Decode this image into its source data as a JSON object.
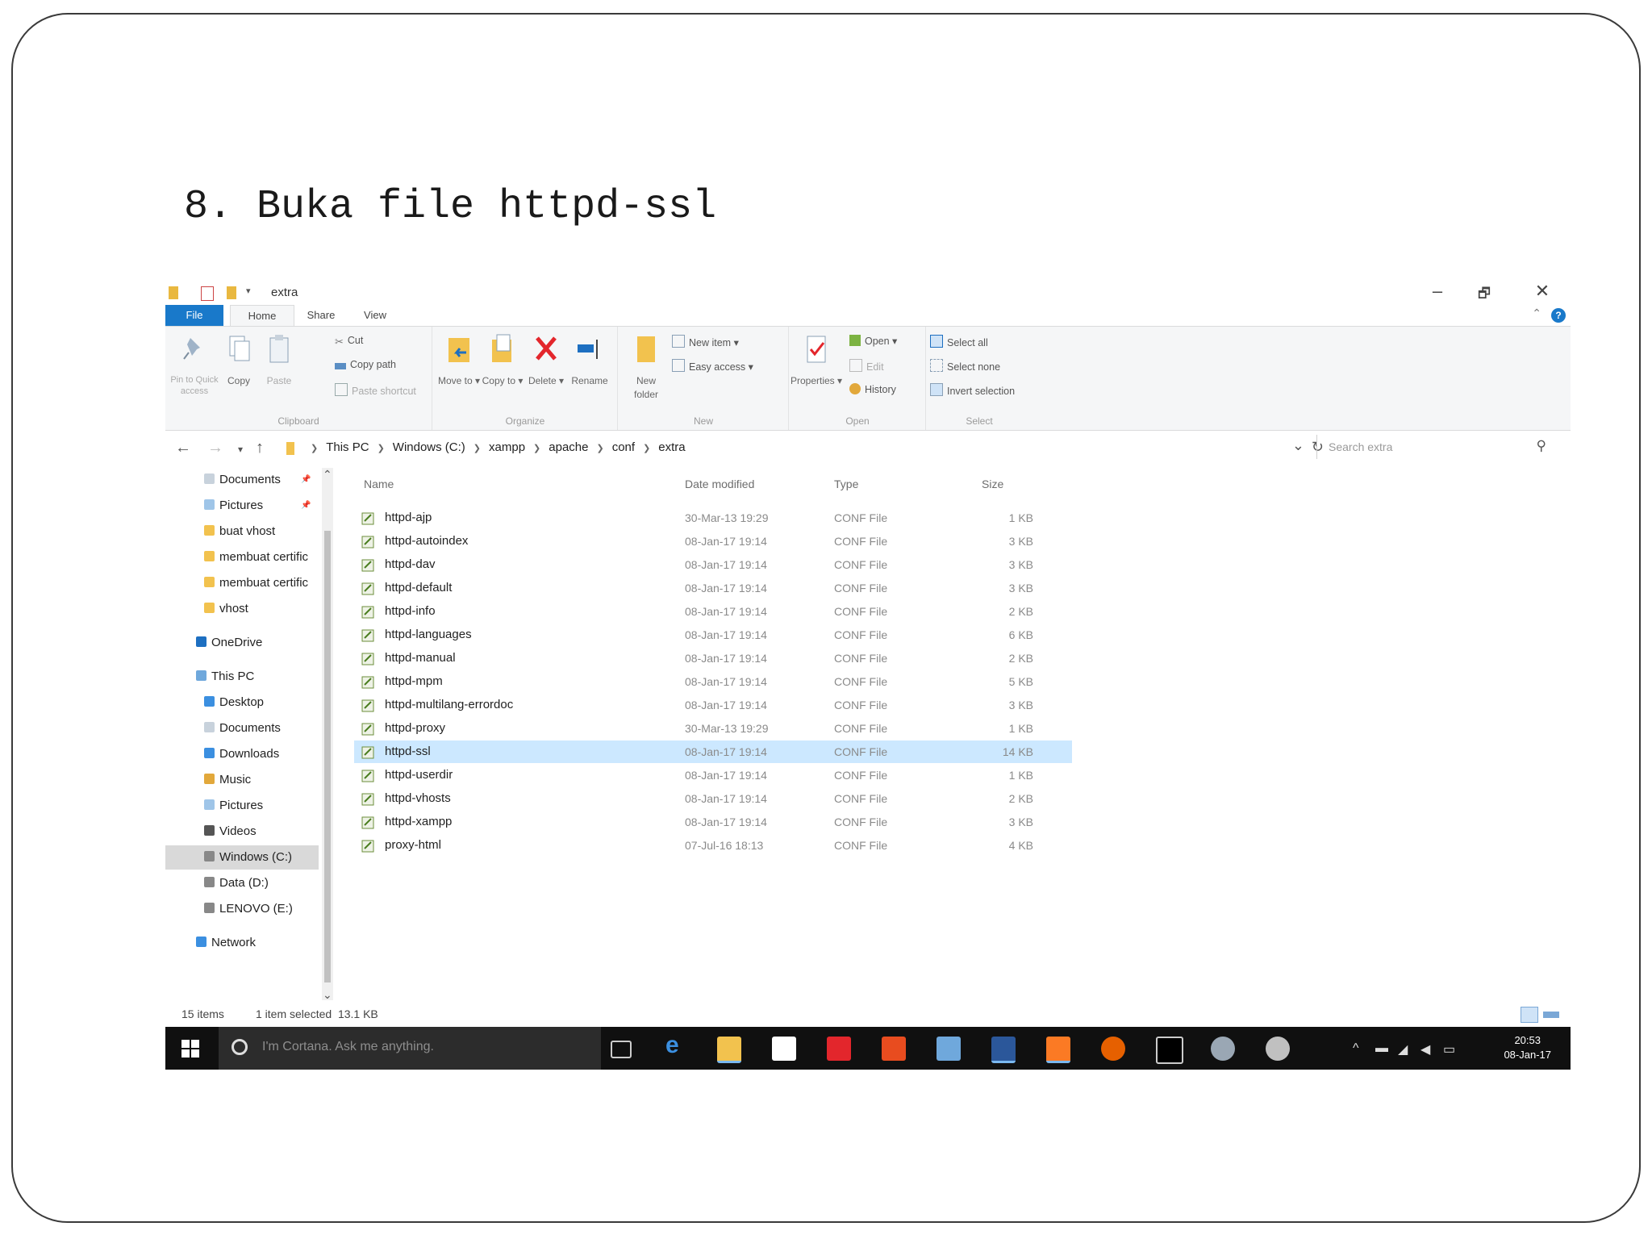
{
  "slide": {
    "title": "8. Buka file httpd-ssl"
  },
  "window": {
    "title": "extra",
    "minimize": "–",
    "restore": "🗗",
    "close": "✕",
    "tabs": {
      "file": "File",
      "home": "Home",
      "share": "Share",
      "view": "View"
    },
    "help": "?"
  },
  "ribbon": {
    "clipboard": {
      "label": "Clipboard",
      "pin": "Pin to Quick access",
      "copy": "Copy",
      "paste": "Paste",
      "cut": "Cut",
      "copy_path": "Copy path",
      "paste_shortcut": "Paste shortcut"
    },
    "organize": {
      "label": "Organize",
      "move_to": "Move to ▾",
      "copy_to": "Copy to ▾",
      "delete": "Delete ▾",
      "rename": "Rename"
    },
    "new": {
      "label": "New",
      "new_folder": "New folder",
      "new_item": "New item ▾",
      "easy_access": "Easy access ▾"
    },
    "open": {
      "label": "Open",
      "properties": "Properties ▾",
      "open": "Open ▾",
      "edit": "Edit",
      "history": "History"
    },
    "select": {
      "label": "Select",
      "select_all": "Select all",
      "select_none": "Select none",
      "invert": "Invert selection"
    }
  },
  "address": {
    "back": "←",
    "forward": "→",
    "recent": "▾",
    "up": "↑",
    "crumbs": [
      "This PC",
      "Windows (C:)",
      "xampp",
      "apache",
      "conf",
      "extra"
    ],
    "dropdown": "⌄",
    "refresh": "↻",
    "search_placeholder": "Search extra"
  },
  "nav": {
    "items": [
      {
        "label": "Documents",
        "pin": "📌"
      },
      {
        "label": "Pictures",
        "pin": "📌"
      },
      {
        "label": "buat vhost"
      },
      {
        "label": "membuat certific"
      },
      {
        "label": "membuat certific"
      },
      {
        "label": "vhost"
      },
      {
        "label": "OneDrive"
      },
      {
        "label": "This PC"
      },
      {
        "label": "Desktop"
      },
      {
        "label": "Documents"
      },
      {
        "label": "Downloads"
      },
      {
        "label": "Music"
      },
      {
        "label": "Pictures"
      },
      {
        "label": "Videos"
      },
      {
        "label": "Windows (C:)"
      },
      {
        "label": "Data (D:)"
      },
      {
        "label": "LENOVO (E:)"
      },
      {
        "label": "Network"
      }
    ],
    "scroll_up": "⌃",
    "scroll_down": "⌄"
  },
  "files": {
    "headers": {
      "name": "Name",
      "date": "Date modified",
      "type": "Type",
      "size": "Size"
    },
    "rows": [
      {
        "name": "httpd-ajp",
        "date": "30-Mar-13 19:29",
        "type": "CONF File",
        "size": "1 KB"
      },
      {
        "name": "httpd-autoindex",
        "date": "08-Jan-17 19:14",
        "type": "CONF File",
        "size": "3 KB"
      },
      {
        "name": "httpd-dav",
        "date": "08-Jan-17 19:14",
        "type": "CONF File",
        "size": "3 KB"
      },
      {
        "name": "httpd-default",
        "date": "08-Jan-17 19:14",
        "type": "CONF File",
        "size": "3 KB"
      },
      {
        "name": "httpd-info",
        "date": "08-Jan-17 19:14",
        "type": "CONF File",
        "size": "2 KB"
      },
      {
        "name": "httpd-languages",
        "date": "08-Jan-17 19:14",
        "type": "CONF File",
        "size": "6 KB"
      },
      {
        "name": "httpd-manual",
        "date": "08-Jan-17 19:14",
        "type": "CONF File",
        "size": "2 KB"
      },
      {
        "name": "httpd-mpm",
        "date": "08-Jan-17 19:14",
        "type": "CONF File",
        "size": "5 KB"
      },
      {
        "name": "httpd-multilang-errordoc",
        "date": "08-Jan-17 19:14",
        "type": "CONF File",
        "size": "3 KB"
      },
      {
        "name": "httpd-proxy",
        "date": "30-Mar-13 19:29",
        "type": "CONF File",
        "size": "1 KB"
      },
      {
        "name": "httpd-ssl",
        "date": "08-Jan-17 19:14",
        "type": "CONF File",
        "size": "14 KB"
      },
      {
        "name": "httpd-userdir",
        "date": "08-Jan-17 19:14",
        "type": "CONF File",
        "size": "1 KB"
      },
      {
        "name": "httpd-vhosts",
        "date": "08-Jan-17 19:14",
        "type": "CONF File",
        "size": "2 KB"
      },
      {
        "name": "httpd-xampp",
        "date": "08-Jan-17 19:14",
        "type": "CONF File",
        "size": "3 KB"
      },
      {
        "name": "proxy-html",
        "date": "07-Jul-16 18:13",
        "type": "CONF File",
        "size": "4 KB"
      }
    ]
  },
  "status": {
    "items": "15 items",
    "selected": "1 item selected  13.1 KB"
  },
  "taskbar": {
    "cortana": "I'm Cortana. Ask me anything.",
    "time": "20:53",
    "date": "08-Jan-17",
    "tray_arrow": "^"
  },
  "colors": {
    "accent": "#1979ca",
    "selection": "#cce8ff",
    "ribbon_bg": "#f5f6f7",
    "taskbar_bg": "#101010"
  }
}
